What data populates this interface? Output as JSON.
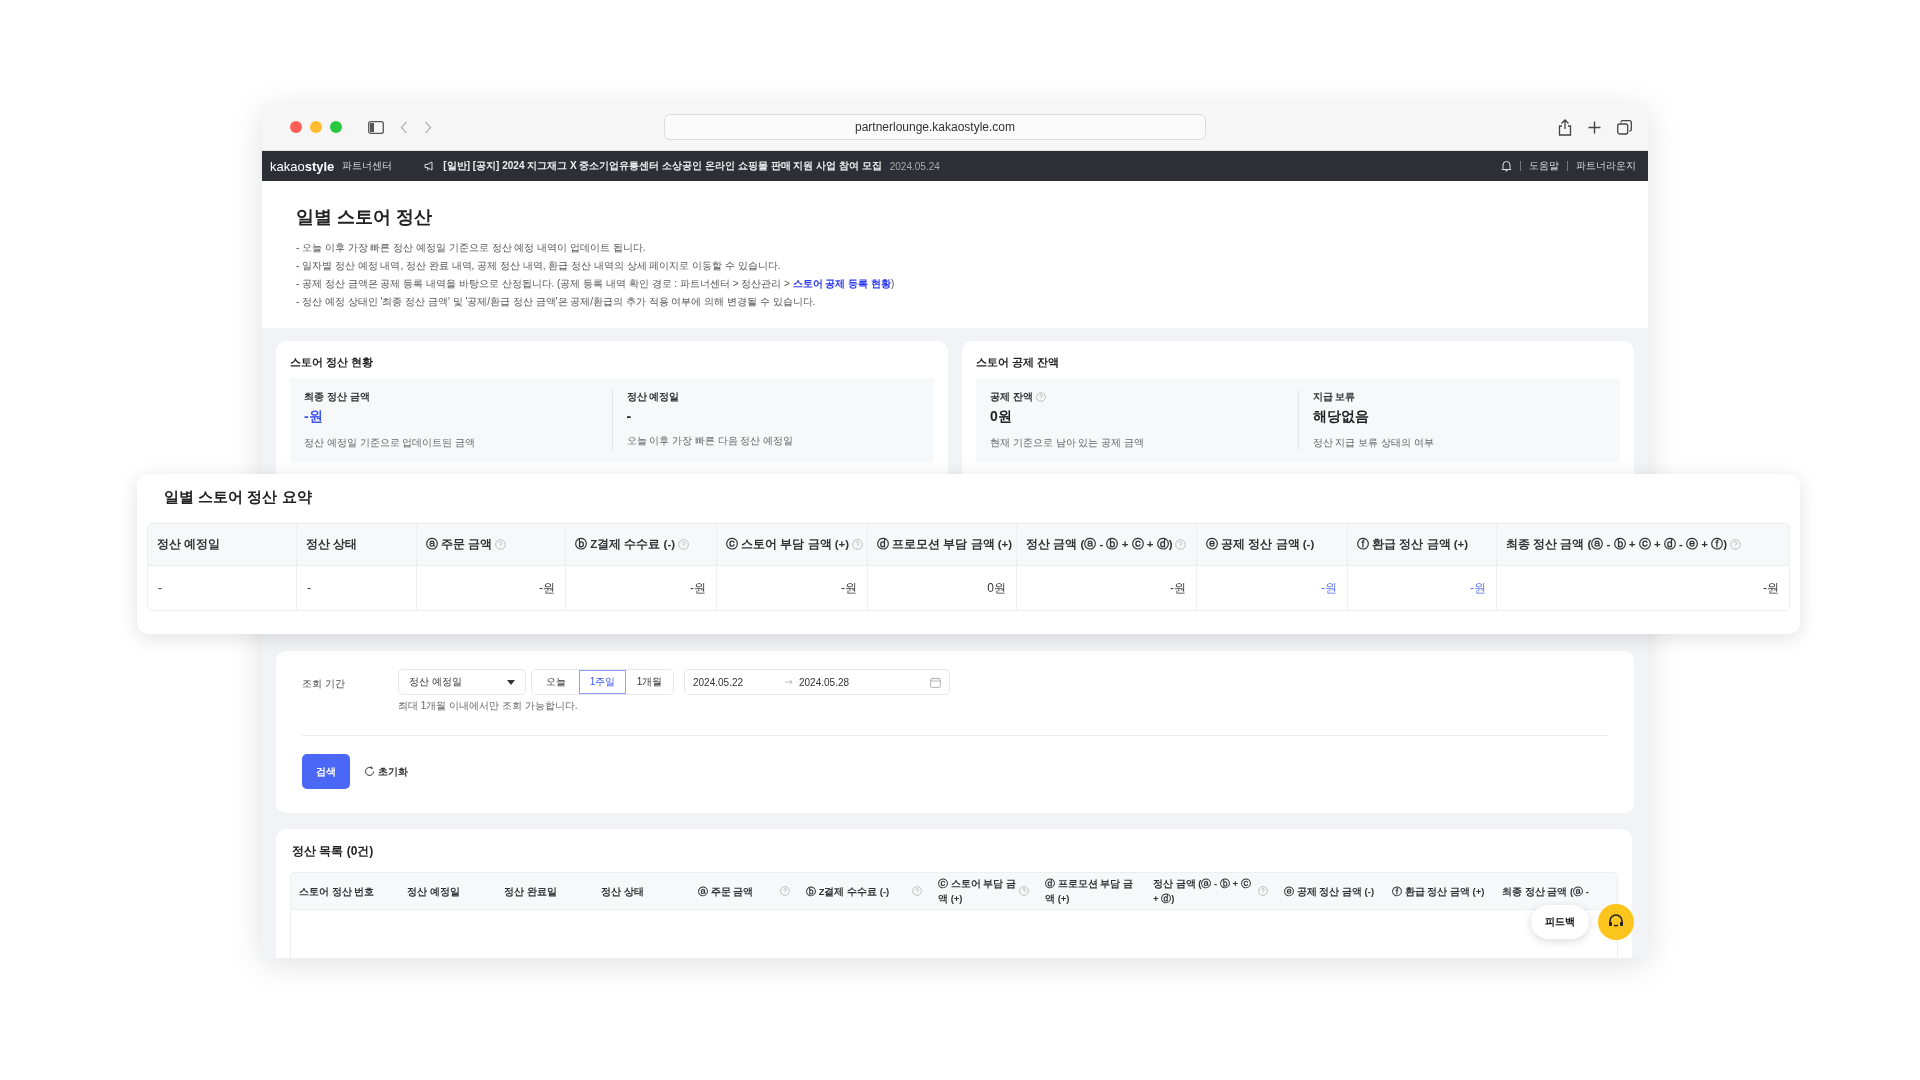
{
  "browser": {
    "url": "partnerlounge.kakaostyle.com"
  },
  "nav": {
    "logo": "kakao**style**",
    "section": "파트너센터",
    "notice": "[일반] [공지] 2024 지그재그 X 중소기업유통센터 소상공인 온라인 쇼핑몰 판매 지원 사업 참여 모집",
    "notice_date": "2024.05.24",
    "links": [
      "도움말",
      "파트너라운지"
    ]
  },
  "header": {
    "title": "일별 스토어 정산",
    "notes": [
      {
        "text": "- 오늘 이후 가장 빠른 정산 예정일 기준으로 정산 예정 내역이 업데이트 됩니다."
      },
      {
        "text": "- 일자별 정산 예정 내역, 정산 완료 내역, 공제 정산 내역, 환급 정산 내역의 상세 페이지로 이동할 수 있습니다."
      },
      {
        "text": "- 공제 정산 금액은 공제 등록 내역을 바탕으로 산정됩니다. (공제 등록 내역 확인 경로 : 파트너센터 > 정산관리 > ",
        "link": "스토어 공제 등록 현황",
        "suffix": ")"
      },
      {
        "text": "- 정산 예정 상태인 '최종 정산 금액' 및 '공제/환급 정산 금액'은 공제/환급의 추가 적용 여부에 의해 변경될 수 있습니다."
      }
    ]
  },
  "cards": [
    {
      "title": "스토어 정산 현황",
      "stats": [
        {
          "label": "최종 정산 금액",
          "help": false,
          "value": "-원",
          "accent": true,
          "note": "정산 예정일 기준으로 업데이트된 금액"
        },
        {
          "label": "정산 예정일",
          "help": false,
          "value": "-",
          "accent": false,
          "note": "오늘 이후 가장 빠른 다음 정산 예정일"
        }
      ]
    },
    {
      "title": "스토어 공제 잔액",
      "stats": [
        {
          "label": "공제 잔액",
          "help": true,
          "value": "0원",
          "accent": false,
          "note": "현재 기준으로 남아 있는 공제 금액"
        },
        {
          "label": "지급 보류",
          "help": false,
          "value": "해당없음",
          "accent": false,
          "note": "정산 지급 보류 상태의 여부"
        }
      ]
    }
  ],
  "summary": {
    "title": "일별 스토어 정산 요약",
    "columns": [
      {
        "label": "정산 예정일",
        "help": false
      },
      {
        "label": "정산 상태",
        "help": false
      },
      {
        "label": "ⓐ 주문 금액",
        "help": true
      },
      {
        "label": "ⓑ Z결제 수수료 (-)",
        "help": true
      },
      {
        "label": "ⓒ 스토어 부담 금액 (+)",
        "help": true
      },
      {
        "label": "ⓓ 프로모션 부담 금액 (+)",
        "help": false
      },
      {
        "label": "정산 금액 (ⓐ - ⓑ + ⓒ + ⓓ)",
        "help": true
      },
      {
        "label": "ⓔ 공제 정산 금액 (-)",
        "help": false
      },
      {
        "label": "ⓕ 환급 정산 금액 (+)",
        "help": false
      },
      {
        "label": "최종 정산 금액 (ⓐ - ⓑ + ⓒ + ⓓ - ⓔ + ⓕ)",
        "help": true
      }
    ],
    "rows": [
      {
        "cells": [
          {
            "kind": "text",
            "text": "-",
            "accent": false
          },
          {
            "kind": "text",
            "text": "-",
            "accent": false
          },
          {
            "kind": "amount",
            "text": "-원",
            "accent": false
          },
          {
            "kind": "amount",
            "text": "-원",
            "accent": false
          },
          {
            "kind": "amount",
            "text": "-원",
            "accent": false
          },
          {
            "kind": "amount",
            "text": "0원",
            "accent": false
          },
          {
            "kind": "amount",
            "text": "-원",
            "accent": false
          },
          {
            "kind": "amount",
            "text": "-원",
            "accent": true
          },
          {
            "kind": "amount",
            "text": "-원",
            "accent": true
          },
          {
            "kind": "amount",
            "text": "-원",
            "accent": false
          }
        ]
      }
    ]
  },
  "filter": {
    "label": "조회 기간",
    "select": "정산 예정일",
    "periods": [
      {
        "label": "오늘",
        "selected": false
      },
      {
        "label": "1주일",
        "selected": true
      },
      {
        "label": "1개월",
        "selected": false
      }
    ],
    "date_from": "2024.05.22",
    "date_to": "2024.05.28",
    "hint": "최대 1개월 이내에서만 조회 가능합니다.",
    "search": "검색",
    "reset": "초기화"
  },
  "list": {
    "title": "정산 목록 (0건)",
    "columns": [
      {
        "label": "스토어 정산 번호",
        "help": false
      },
      {
        "label": "정산 예정일",
        "help": false
      },
      {
        "label": "정산 완료일",
        "help": false
      },
      {
        "label": "정산 상태",
        "help": false
      },
      {
        "label": "ⓐ 주문 금액",
        "help": true
      },
      {
        "label": "ⓑ Z결제 수수료 (-)",
        "help": true
      },
      {
        "label": "ⓒ 스토어 부담 금액 (+)",
        "help": true
      },
      {
        "label": "ⓓ 프로모션 부담 금액 (+)",
        "help": false
      },
      {
        "label": "정산 금액 (ⓐ - ⓑ + ⓒ + ⓓ)",
        "help": true
      },
      {
        "label": "ⓔ 공제 정산 금액 (-)",
        "help": false
      },
      {
        "label": "ⓕ 환급 정산 금액 (+)",
        "help": false
      },
      {
        "label": "최종 정산 금액 (ⓐ -",
        "help": false
      }
    ]
  },
  "feedback": {
    "label": "피드백"
  }
}
